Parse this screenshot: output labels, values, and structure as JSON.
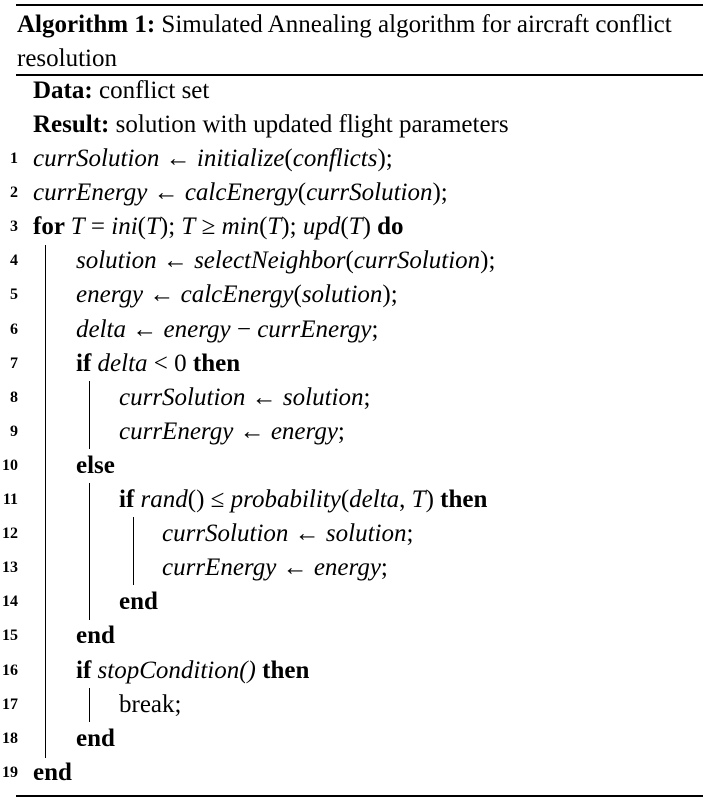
{
  "algorithm": {
    "label": "Algorithm 1:",
    "caption": "Simulated Annealing algorithm for aircraft conflict resolution",
    "data_label": "Data:",
    "data_text": "conflict set",
    "result_label": "Result:",
    "result_text": "solution with updated flight parameters",
    "lines": [
      {
        "no": "1",
        "parts": [
          [
            "m",
            "currSolution"
          ],
          [
            "t",
            " ← "
          ],
          [
            "m",
            "initialize"
          ],
          [
            "t",
            "("
          ],
          [
            "m",
            "conflicts"
          ],
          [
            "t",
            ");"
          ]
        ]
      },
      {
        "no": "2",
        "parts": [
          [
            "m",
            "currEnergy"
          ],
          [
            "t",
            " ← "
          ],
          [
            "m",
            "calcEnergy"
          ],
          [
            "t",
            "("
          ],
          [
            "m",
            "currSolution"
          ],
          [
            "t",
            ");"
          ]
        ]
      },
      {
        "no": "3",
        "parts": [
          [
            "k",
            "for "
          ],
          [
            "m",
            "T"
          ],
          [
            "t",
            " = "
          ],
          [
            "m",
            "ini"
          ],
          [
            "t",
            "("
          ],
          [
            "m",
            "T"
          ],
          [
            "t",
            "); "
          ],
          [
            "m",
            "T"
          ],
          [
            "t",
            " ≥ "
          ],
          [
            "m",
            "min"
          ],
          [
            "t",
            "("
          ],
          [
            "m",
            "T"
          ],
          [
            "t",
            "); "
          ],
          [
            "m",
            "upd"
          ],
          [
            "t",
            "("
          ],
          [
            "m",
            "T"
          ],
          [
            "t",
            ") "
          ],
          [
            "k",
            "do"
          ]
        ]
      },
      {
        "no": "4",
        "parts": [
          [
            "m",
            "solution"
          ],
          [
            "t",
            " ← "
          ],
          [
            "m",
            "selectNeighbor"
          ],
          [
            "t",
            "("
          ],
          [
            "m",
            "currSolution"
          ],
          [
            "t",
            ");"
          ]
        ]
      },
      {
        "no": "5",
        "parts": [
          [
            "m",
            "energy"
          ],
          [
            "t",
            " ← "
          ],
          [
            "m",
            "calcEnergy"
          ],
          [
            "t",
            "("
          ],
          [
            "m",
            "solution"
          ],
          [
            "t",
            ");"
          ]
        ]
      },
      {
        "no": "6",
        "parts": [
          [
            "m",
            "delta"
          ],
          [
            "t",
            " ← "
          ],
          [
            "m",
            "energy"
          ],
          [
            "t",
            " − "
          ],
          [
            "m",
            "currEnergy"
          ],
          [
            "t",
            ";"
          ]
        ]
      },
      {
        "no": "7",
        "parts": [
          [
            "k",
            "if "
          ],
          [
            "m",
            "delta"
          ],
          [
            "t",
            " < 0 "
          ],
          [
            "k",
            "then"
          ]
        ]
      },
      {
        "no": "8",
        "parts": [
          [
            "m",
            "currSolution"
          ],
          [
            "t",
            " ← "
          ],
          [
            "m",
            "solution"
          ],
          [
            "t",
            ";"
          ]
        ]
      },
      {
        "no": "9",
        "parts": [
          [
            "m",
            "currEnergy"
          ],
          [
            "t",
            " ← "
          ],
          [
            "m",
            "energy"
          ],
          [
            "t",
            ";"
          ]
        ]
      },
      {
        "no": "10",
        "parts": [
          [
            "k",
            "else"
          ]
        ]
      },
      {
        "no": "11",
        "parts": [
          [
            "k",
            "if "
          ],
          [
            "m",
            "rand"
          ],
          [
            "t",
            "() ≤ "
          ],
          [
            "m",
            "probability"
          ],
          [
            "t",
            "("
          ],
          [
            "m",
            "delta"
          ],
          [
            "t",
            ", "
          ],
          [
            "m",
            "T"
          ],
          [
            "t",
            ") "
          ],
          [
            "k",
            "then"
          ]
        ]
      },
      {
        "no": "12",
        "parts": [
          [
            "m",
            "currSolution"
          ],
          [
            "t",
            " ← "
          ],
          [
            "m",
            "solution"
          ],
          [
            "t",
            ";"
          ]
        ]
      },
      {
        "no": "13",
        "parts": [
          [
            "m",
            "currEnergy"
          ],
          [
            "t",
            " ← "
          ],
          [
            "m",
            "energy"
          ],
          [
            "t",
            ";"
          ]
        ]
      },
      {
        "no": "14",
        "parts": [
          [
            "k",
            "end"
          ]
        ]
      },
      {
        "no": "15",
        "parts": [
          [
            "k",
            "end"
          ]
        ]
      },
      {
        "no": "16",
        "parts": [
          [
            "k",
            "if "
          ],
          [
            "m",
            "stopCondition()"
          ],
          [
            "t",
            " "
          ],
          [
            "k",
            "then"
          ]
        ]
      },
      {
        "no": "17",
        "parts": [
          [
            "t",
            "break;"
          ]
        ]
      },
      {
        "no": "18",
        "parts": [
          [
            "k",
            "end"
          ]
        ]
      },
      {
        "no": "19",
        "parts": [
          [
            "k",
            "end"
          ]
        ]
      }
    ]
  }
}
